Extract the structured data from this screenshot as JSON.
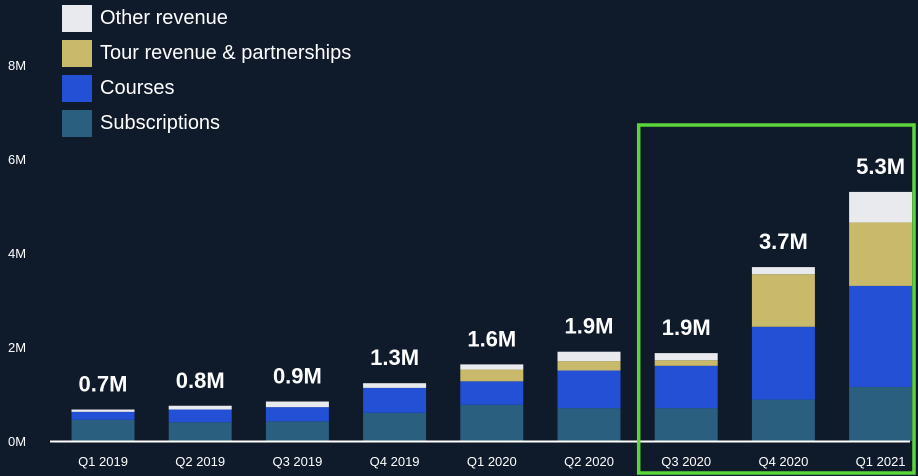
{
  "chart_data": {
    "type": "bar",
    "stacked": true,
    "title": "",
    "xlabel": "",
    "ylabel": "",
    "ylim": [
      0,
      8.4
    ],
    "yticks": [
      0,
      2,
      4,
      6,
      8
    ],
    "ytick_labels": [
      "0M",
      "2M",
      "4M",
      "6M",
      "8M"
    ],
    "categories": [
      "Q1 2019",
      "Q2 2019",
      "Q3 2019",
      "Q4 2019",
      "Q1 2020",
      "Q2 2020",
      "Q3 2020",
      "Q4 2020",
      "Q1 2021"
    ],
    "series": [
      {
        "name": "Subscriptions",
        "color": "#2a5f80",
        "values": [
          0.45,
          0.4,
          0.42,
          0.6,
          0.77,
          0.7,
          0.7,
          0.88,
          1.15
        ]
      },
      {
        "name": "Courses",
        "color": "#2350d4",
        "values": [
          0.17,
          0.27,
          0.3,
          0.53,
          0.5,
          0.8,
          0.9,
          1.55,
          2.15
        ]
      },
      {
        "name": "Tour revenue & partnerships",
        "color": "#c8b96b",
        "values": [
          0.0,
          0.0,
          0.0,
          0.0,
          0.25,
          0.2,
          0.12,
          1.12,
          1.35
        ]
      },
      {
        "name": "Other revenue",
        "color": "#e8eaee",
        "values": [
          0.05,
          0.08,
          0.12,
          0.1,
          0.11,
          0.2,
          0.15,
          0.15,
          0.65
        ]
      }
    ],
    "totals_labels": [
      "0.7M",
      "0.8M",
      "0.9M",
      "1.3M",
      "1.6M",
      "1.9M",
      "1.9M",
      "3.7M",
      "5.3M"
    ],
    "legend_position": "top-left",
    "grid": false,
    "highlight": {
      "categories": [
        "Q3 2020",
        "Q4 2020",
        "Q1 2021"
      ],
      "color": "#5bd63a"
    }
  }
}
